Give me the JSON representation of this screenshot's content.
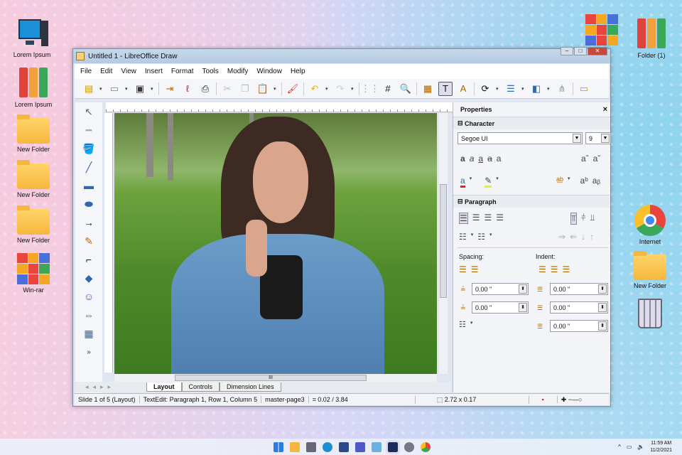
{
  "desktop": {
    "left_icons": [
      {
        "label": "Lorem Ipsum",
        "icon": "computer-icon"
      },
      {
        "label": "Lorem Ipsum",
        "icon": "binders-icon"
      },
      {
        "label": "New Folder",
        "icon": "folder-icon"
      },
      {
        "label": "New Folder",
        "icon": "folder-icon"
      },
      {
        "label": "New Folder",
        "icon": "folder-icon"
      },
      {
        "label": "Win-rar",
        "icon": "winrar-icon"
      }
    ],
    "right_icons": [
      {
        "label": "",
        "icon": "winrar-icon"
      },
      {
        "label": "Folder (1)",
        "icon": "binders-icon"
      },
      {
        "label": "Internet",
        "icon": "chrome-icon"
      },
      {
        "label": "New Folder",
        "icon": "folder-icon"
      },
      {
        "label": "",
        "icon": "recycle-bin-icon"
      }
    ]
  },
  "window": {
    "title": "Untitled 1 - LibreOffice Draw",
    "menu": [
      "File",
      "Edit",
      "View",
      "Insert",
      "Format",
      "Tools",
      "Modify",
      "Window",
      "Help"
    ],
    "tabs": [
      "Layout",
      "Controls",
      "Dimension Lines"
    ],
    "status": {
      "slide": "Slide 1 of 5 (Layout)",
      "textedit": "TextEdit: Paragraph 1, Row 1, Column 5",
      "master": "master-page3",
      "position": "0.02 / 3.84",
      "size": "2.72 x 0.17"
    },
    "properties": {
      "title": "Properties",
      "close": "×",
      "character": "Character",
      "font": "Segoe UI",
      "size": "9",
      "paragraph": "Paragraph",
      "spacing": "Spacing:",
      "indent": "Indent:",
      "above": "0.00 \"",
      "below": "0.00 \"",
      "before": "0.00 \"",
      "after": "0.00 \"",
      "first": "0.00 \""
    }
  },
  "taskbar": {
    "time": "11:59 AM",
    "date": "11/2/2021"
  },
  "colors": {
    "accent": "#3a6ea5",
    "titlebar": "#b5cbe2"
  }
}
